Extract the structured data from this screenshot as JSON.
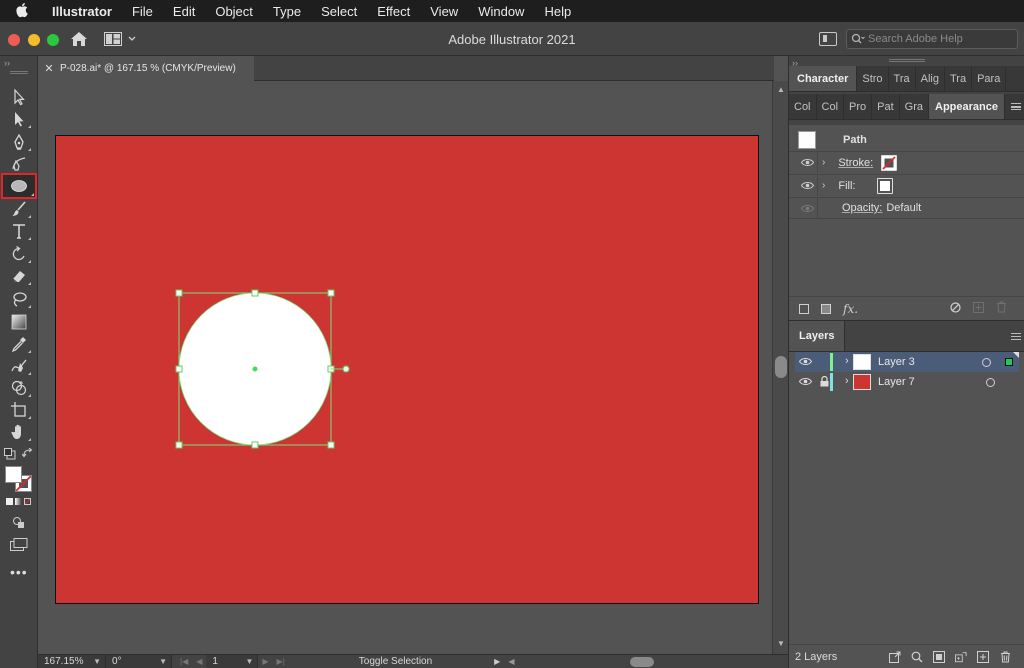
{
  "menubar": {
    "items": [
      "Illustrator",
      "File",
      "Edit",
      "Object",
      "Type",
      "Select",
      "Effect",
      "View",
      "Window",
      "Help"
    ]
  },
  "titlebar": {
    "title": "Adobe Illustrator 2021",
    "search_placeholder": "Search Adobe Help"
  },
  "document": {
    "tab_label": "P-028.ai* @ 167.15 % (CMYK/Preview)",
    "artboard_color": "#cd3532",
    "shape_fill": "#ffffff",
    "selection_color": "#7de07d"
  },
  "tools": [
    {
      "name": "selection-tool-icon"
    },
    {
      "name": "direct-selection-tool-icon"
    },
    {
      "name": "pen-tool-icon"
    },
    {
      "name": "curvature-tool-icon"
    },
    {
      "name": "ellipse-tool-icon",
      "selected": true
    },
    {
      "name": "paintbrush-tool-icon"
    },
    {
      "name": "type-tool-icon"
    },
    {
      "name": "rotate-tool-icon"
    },
    {
      "name": "eraser-tool-icon"
    },
    {
      "name": "lasso-tool-icon"
    },
    {
      "name": "gradient-tool-icon"
    },
    {
      "name": "eyedropper-tool-icon"
    },
    {
      "name": "blend-tool-icon"
    },
    {
      "name": "shape-builder-tool-icon"
    },
    {
      "name": "artboard-tool-icon"
    },
    {
      "name": "hand-tool-icon"
    }
  ],
  "statusbar": {
    "zoom": "167.15%",
    "rotation": "0°",
    "artboard_number": "1",
    "status_text": "Toggle Selection"
  },
  "panels": {
    "top_tabs": [
      "Character",
      "Stro",
      "Tra",
      "Alig",
      "Tra",
      "Para"
    ],
    "second_tabs": [
      "Col",
      "Col",
      "Pro",
      "Pat",
      "Gra",
      "Appearance"
    ],
    "appearance": {
      "object_type": "Path",
      "stroke_label": "Stroke:",
      "fill_label": "Fill:",
      "opacity_label": "Opacity:",
      "opacity_value": "Default"
    },
    "layers": {
      "tab": "Layers",
      "items": [
        {
          "name": "Layer 3",
          "color": "#7df28a",
          "thumb": "#ffffff",
          "selected": true,
          "locked": false
        },
        {
          "name": "Layer 7",
          "color": "#7fe1e6",
          "thumb": "#cd3532",
          "selected": false,
          "locked": true
        }
      ],
      "count": "2 Layers"
    }
  }
}
